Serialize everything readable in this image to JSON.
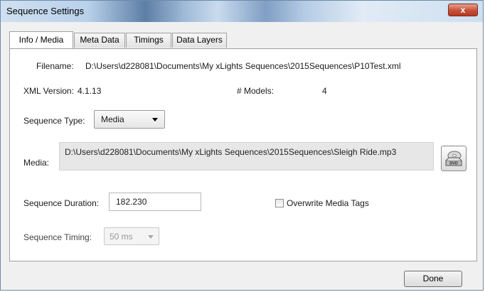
{
  "window": {
    "title": "Sequence Settings",
    "close_glyph": "x"
  },
  "tabs": [
    {
      "label": "Info / Media",
      "active": true
    },
    {
      "label": "Meta Data",
      "active": false
    },
    {
      "label": "Timings",
      "active": false
    },
    {
      "label": "Data Layers",
      "active": false
    }
  ],
  "info": {
    "filename_label": "Filename:",
    "filename_value": "D:\\Users\\d228081\\Documents\\My xLights Sequences\\2015Sequences\\P10Test.xml",
    "xml_version_label": "XML Version:",
    "xml_version_value": "4.1.13",
    "models_label": "# Models:",
    "models_value": "4",
    "sequence_type_label": "Sequence Type:",
    "sequence_type_value": "Media",
    "media_label": "Media:",
    "media_value": "D:\\Users\\d228081\\Documents\\My xLights Sequences\\2015Sequences\\Sleigh Ride.mp3",
    "media_button_icon": "dvd-drive-icon",
    "media_button_text": "DVD",
    "duration_label": "Sequence Duration:",
    "duration_value": "182.230",
    "overwrite_label": "Overwrite Media Tags",
    "overwrite_checked": false,
    "timing_label": "Sequence Timing:",
    "timing_value": "50 ms"
  },
  "footer": {
    "done_label": "Done"
  },
  "colors": {
    "close_button": "#c7503a",
    "panel_bg": "#ffffff",
    "window_bg": "#f0f0f0"
  }
}
